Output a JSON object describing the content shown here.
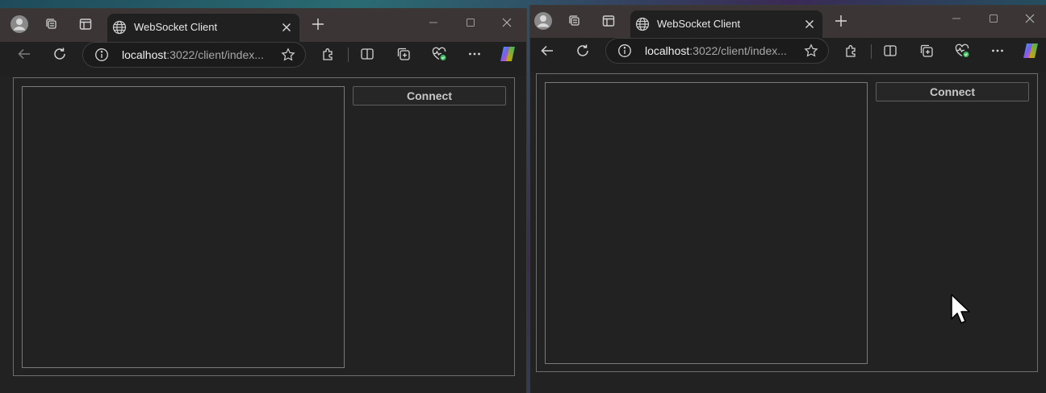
{
  "windows": [
    {
      "id": "left",
      "tab_title": "WebSocket Client",
      "address_host": "localhost",
      "address_rest": ":3022/client/index...",
      "connect_label": "Connect"
    },
    {
      "id": "right",
      "tab_title": "WebSocket Client",
      "address_host": "localhost",
      "address_rest": ":3022/client/index...",
      "connect_label": "Connect"
    }
  ],
  "icons": {
    "profile": "profile-avatar-icon",
    "workspaces": "workspaces-icon",
    "tab_actions": "vertical-tabs-icon",
    "tab_site": "globe-icon",
    "tab_close": "close-icon",
    "new_tab": "plus-icon",
    "minimize": "minimize-icon",
    "maximize": "maximize-icon",
    "close": "close-icon",
    "back": "back-arrow-icon",
    "refresh": "refresh-icon",
    "info": "info-icon",
    "favorite": "star-icon",
    "extensions": "puzzle-icon",
    "split_screen": "split-screen-icon",
    "collections": "collections-icon",
    "browser_essentials": "heart-pulse-icon",
    "more": "more-dots-icon",
    "copilot": "copilot-icon"
  },
  "colors": {
    "tab_bar": "#3b3536",
    "page_background": "#222222",
    "accent_green": "#3fbf5f"
  }
}
